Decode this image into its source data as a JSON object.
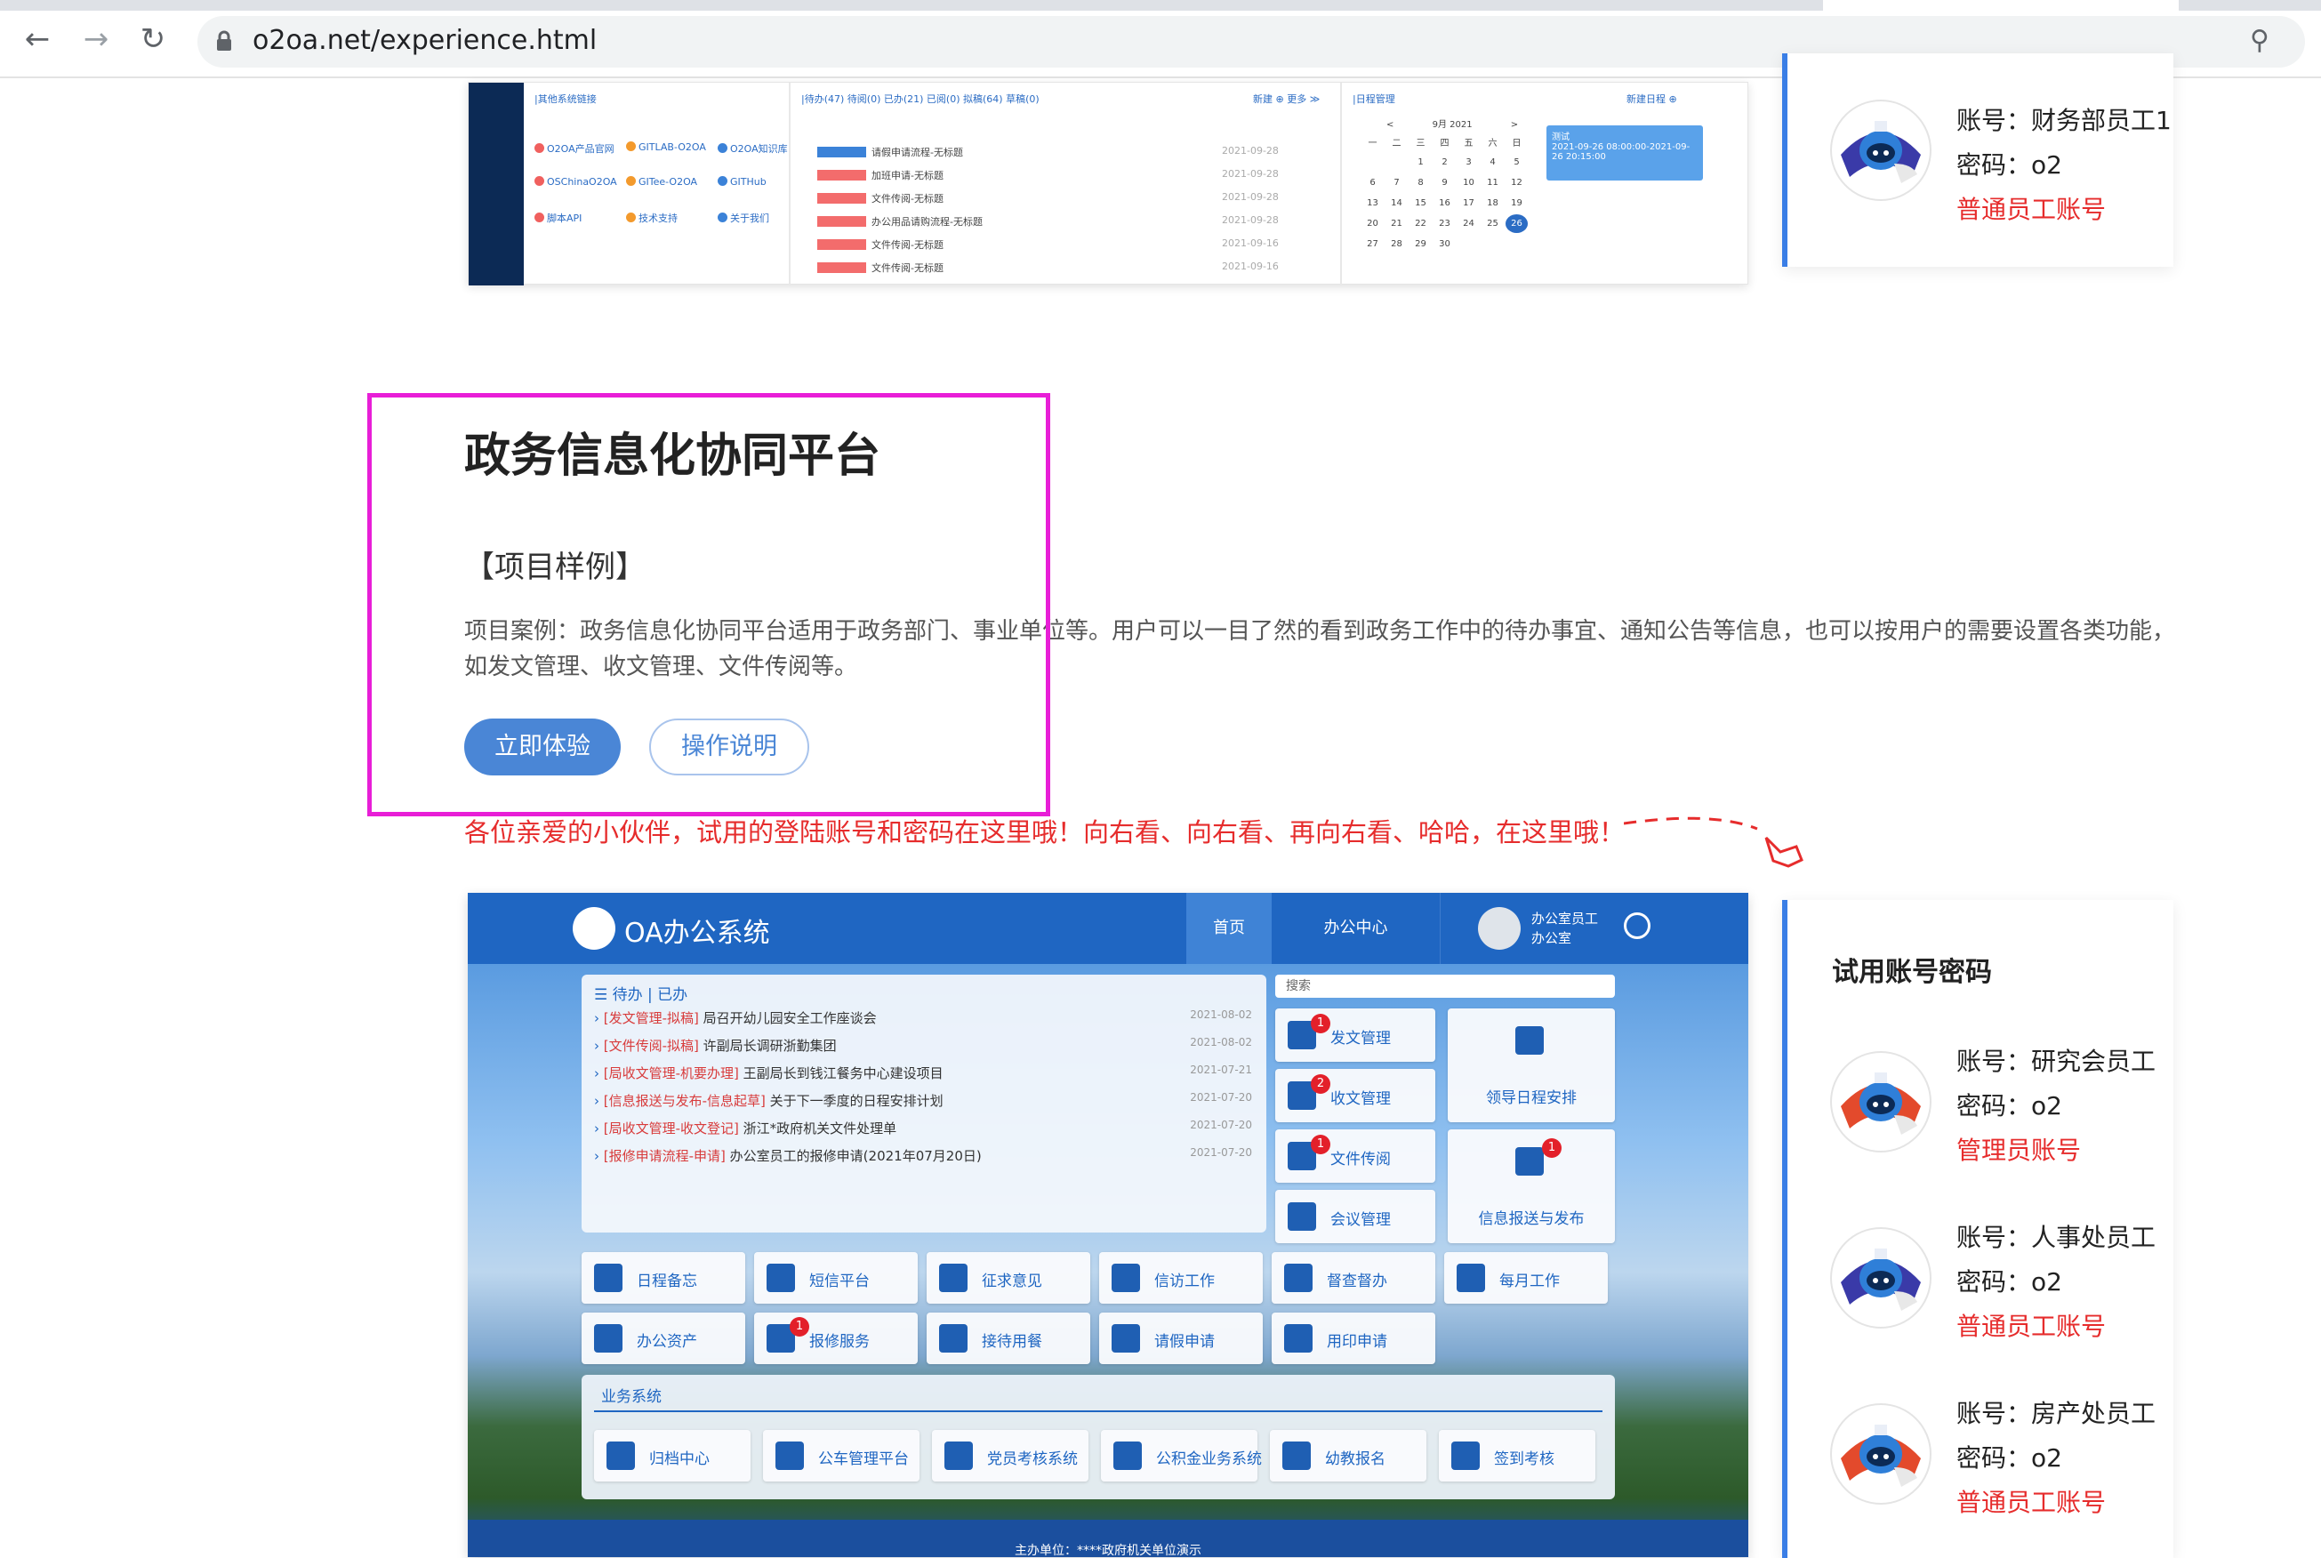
{
  "browser": {
    "url": "o2oa.net/experience.html",
    "back_icon": "←",
    "forward_icon": "→",
    "reload_icon": "↻",
    "zoom_icon": "⚲"
  },
  "top_screenshot": {
    "links_header": "|其他系统链接",
    "links": [
      {
        "label": "O2OA产品官网",
        "color": "#f0605e"
      },
      {
        "label": "GITLAB-O2OA",
        "color": "#f39a2d"
      },
      {
        "label": "O2OA知识库",
        "color": "#3b82d8"
      },
      {
        "label": "OSChinaO2OA",
        "color": "#f0605e"
      },
      {
        "label": "GITee-O2OA",
        "color": "#f39a2d"
      },
      {
        "label": "GITHub",
        "color": "#3b82d8"
      },
      {
        "label": "脚本API",
        "color": "#f0605e"
      },
      {
        "label": "技术支持",
        "color": "#f39a2d"
      },
      {
        "label": "关于我们",
        "color": "#3b82d8"
      }
    ],
    "todo_header": "|待办(47)  待阅(0)  已办(21)  已阅(0)  拟稿(64)  草稿(0)",
    "todo_new": "新建 ⊕  更多 ≫",
    "todo_items": [
      {
        "text": "请假申请流程-无标题",
        "date": "2021-09-28",
        "tag": "blue"
      },
      {
        "text": "加班申请-无标题",
        "date": "2021-09-28",
        "tag": "red"
      },
      {
        "text": "文件传阅-无标题",
        "date": "2021-09-28",
        "tag": "red"
      },
      {
        "text": "办公用品请购流程-无标题",
        "date": "2021-09-28",
        "tag": "red"
      },
      {
        "text": "文件传阅-无标题",
        "date": "2021-09-16",
        "tag": "red"
      },
      {
        "text": "文件传阅-无标题",
        "date": "2021-09-16",
        "tag": "red"
      }
    ],
    "cal_header": "|日程管理",
    "cal_new": "新建日程 ⊕",
    "cal_month": "9月 2021",
    "cal_weekdays": [
      "一",
      "二",
      "三",
      "四",
      "五",
      "六",
      "日"
    ],
    "cal_rows": [
      [
        "",
        "",
        "1",
        "2",
        "3",
        "4",
        "5"
      ],
      [
        "6",
        "7",
        "8",
        "9",
        "10",
        "11",
        "12"
      ],
      [
        "13",
        "14",
        "15",
        "16",
        "17",
        "18",
        "19"
      ],
      [
        "20",
        "21",
        "22",
        "23",
        "24",
        "25",
        "26"
      ],
      [
        "27",
        "28",
        "29",
        "30",
        "",
        "",
        ""
      ]
    ],
    "event_title": "测试",
    "event_time": "2021-09-26 08:00:00-2021-09-26 20:15:00"
  },
  "account_top": {
    "user": "账号：财务部员工1",
    "password": "密码：o2",
    "role": "普通员工账号"
  },
  "project": {
    "title": "政务信息化协同平台",
    "subtitle": "【项目样例】",
    "description": "项目案例：政务信息化协同平台适用于政务部门、事业单位等。用户可以一目了然的看到政务工作中的待办事宜、通知公告等信息，也可以按用户的需要设置各类功能，如发文管理、收文管理、文件传阅等。",
    "try_button": "立即体验",
    "guide_button": "操作说明",
    "hint": "各位亲爱的小伙伴，试用的登陆账号和密码在这里哦！向右看、向右看、再向右看、哈哈，在这里哦！"
  },
  "oa": {
    "app_name": "OA办公系统",
    "nav_home": "首页",
    "nav_office": "办公中心",
    "user_name": "办公室员工",
    "user_dept": "办公室",
    "todo_head": "☰ 待办  | 已办",
    "todo_items": [
      {
        "tag": "[发文管理-拟稿]",
        "text": " 局召开幼儿园安全工作座谈会",
        "date": "2021-08-02"
      },
      {
        "tag": "[文件传阅-拟稿]",
        "text": " 许副局长调研浙勤集团",
        "date": "2021-08-02"
      },
      {
        "tag": "[局收文管理-机要办理]",
        "text": " 王副局长到钱江餐务中心建设项目",
        "date": "2021-07-21"
      },
      {
        "tag": "[信息报送与发布-信息起草]",
        "text": " 关于下一季度的日程安排计划",
        "date": "2021-07-20"
      },
      {
        "tag": "[局收文管理-收文登记]",
        "text": " 浙江*政府机关文件处理单",
        "date": "2021-07-20"
      },
      {
        "tag": "[报修申请流程-申请]",
        "text": " 办公室员工的报修申请(2021年07月20日)",
        "date": "2021-07-20"
      }
    ],
    "search_placeholder": "搜索",
    "right_tiles": [
      {
        "label": "发文管理",
        "badge": "1"
      },
      {
        "label": "收文管理",
        "badge": "2"
      },
      {
        "label": "文件传阅",
        "badge": "1"
      },
      {
        "label": "会议管理",
        "badge": ""
      }
    ],
    "big_tiles": [
      {
        "label": "领导日程安排",
        "badge": ""
      },
      {
        "label": "信息报送与发布",
        "badge": "1"
      }
    ],
    "row1": [
      "日程备忘",
      "短信平台",
      "征求意见",
      "信访工作",
      "督查督办",
      "每月工作"
    ],
    "row2": [
      {
        "label": "办公资产",
        "badge": ""
      },
      {
        "label": "报修服务",
        "badge": "1"
      },
      {
        "label": "接待用餐",
        "badge": ""
      },
      {
        "label": "请假申请",
        "badge": ""
      },
      {
        "label": "用印申请",
        "badge": ""
      }
    ],
    "biz_head": "业务系统",
    "biz_items": [
      "归档中心",
      "公车管理平台",
      "党员考核系统",
      "公积金业务系统",
      "幼教报名",
      "签到考核"
    ],
    "footer": "主办单位：****政府机关单位演示"
  },
  "trial": {
    "title": "试用账号密码",
    "accounts": [
      {
        "user": "账号：研究会员工",
        "password": "密码：o2",
        "role": "管理员账号"
      },
      {
        "user": "账号：人事处员工",
        "password": "密码：o2",
        "role": "普通员工账号"
      },
      {
        "user": "账号：房产处员工",
        "password": "密码：o2",
        "role": "普通员工账号"
      }
    ]
  }
}
